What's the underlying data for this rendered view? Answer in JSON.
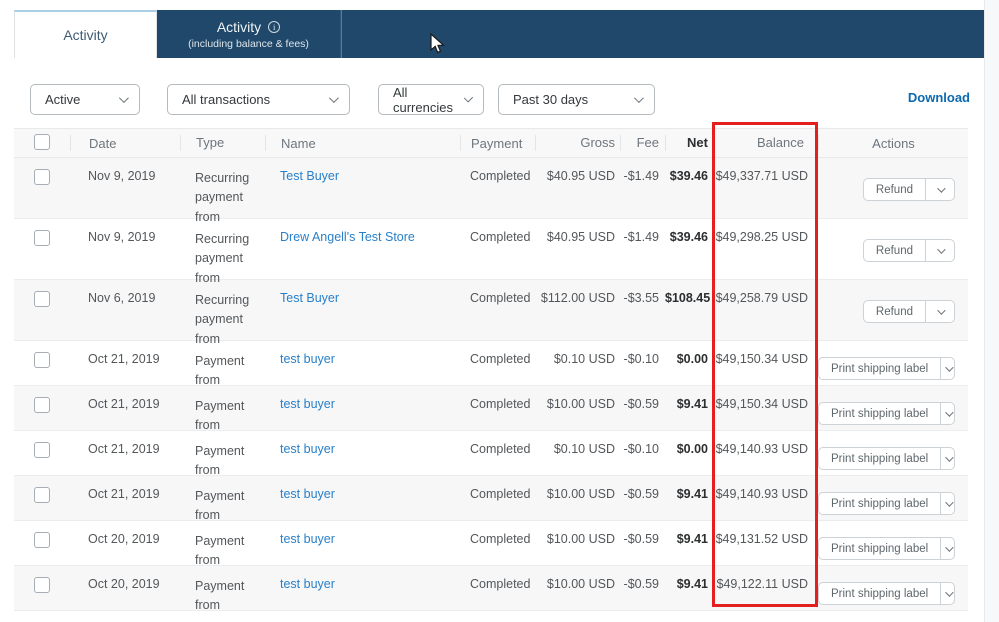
{
  "tabs": [
    {
      "label": "Activity",
      "active": true
    },
    {
      "label": "Activity",
      "sublabel": "(including balance & fees)",
      "info_icon": "i"
    }
  ],
  "filters": [
    {
      "name": "status-filter",
      "value": "Active"
    },
    {
      "name": "transaction-type-filter",
      "value": "All transactions"
    },
    {
      "name": "currency-filter",
      "value": "All currencies"
    },
    {
      "name": "date-range-filter",
      "value": "Past 30 days"
    }
  ],
  "download_label": "Download",
  "table": {
    "headers": [
      {
        "label": "Date"
      },
      {
        "label": "Type"
      },
      {
        "label": "Name"
      },
      {
        "label": "Payment"
      },
      {
        "label": "Gross"
      },
      {
        "label": "Fee"
      },
      {
        "label": "Net"
      },
      {
        "label": "Balance"
      },
      {
        "label": "Actions"
      }
    ],
    "rows": [
      {
        "date": "Nov 9, 2019",
        "type": "Recurring payment from",
        "name": "Test Buyer",
        "payment": "Completed",
        "gross": "$40.95 USD",
        "fee": "-$1.49",
        "net": "$39.46",
        "balance": "$49,337.71 USD",
        "action": "Refund"
      },
      {
        "date": "Nov 9, 2019",
        "type": "Recurring payment from",
        "name": "Drew Angell's Test Store",
        "payment": "Completed",
        "gross": "$40.95 USD",
        "fee": "-$1.49",
        "net": "$39.46",
        "balance": "$49,298.25 USD",
        "action": "Refund"
      },
      {
        "date": "Nov 6, 2019",
        "type": "Recurring payment from",
        "name": "Test Buyer",
        "payment": "Completed",
        "gross": "$112.00 USD",
        "fee": "-$3.55",
        "net": "$108.45",
        "balance": "$49,258.79 USD",
        "action": "Refund"
      },
      {
        "date": "Oct 21, 2019",
        "type": "Payment from",
        "name": "test buyer",
        "payment": "Completed",
        "gross": "$0.10 USD",
        "fee": "-$0.10",
        "net": "$0.00",
        "balance": "$49,150.34 USD",
        "action": "Print shipping label"
      },
      {
        "date": "Oct 21, 2019",
        "type": "Payment from",
        "name": "test buyer",
        "payment": "Completed",
        "gross": "$10.00 USD",
        "fee": "-$0.59",
        "net": "$9.41",
        "balance": "$49,150.34 USD",
        "action": "Print shipping label"
      },
      {
        "date": "Oct 21, 2019",
        "type": "Payment from",
        "name": "test buyer",
        "payment": "Completed",
        "gross": "$0.10 USD",
        "fee": "-$0.10",
        "net": "$0.00",
        "balance": "$49,140.93 USD",
        "action": "Print shipping label"
      },
      {
        "date": "Oct 21, 2019",
        "type": "Payment from",
        "name": "test buyer",
        "payment": "Completed",
        "gross": "$10.00 USD",
        "fee": "-$0.59",
        "net": "$9.41",
        "balance": "$49,140.93 USD",
        "action": "Print shipping label"
      },
      {
        "date": "Oct 20, 2019",
        "type": "Payment from",
        "name": "test buyer",
        "payment": "Completed",
        "gross": "$10.00 USD",
        "fee": "-$0.59",
        "net": "$9.41",
        "balance": "$49,131.52 USD",
        "action": "Print shipping label"
      },
      {
        "date": "Oct 20, 2019",
        "type": "Payment from",
        "name": "test buyer",
        "payment": "Completed",
        "gross": "$10.00 USD",
        "fee": "-$0.59",
        "net": "$9.41",
        "balance": "$49,122.11 USD",
        "action": "Print shipping label"
      }
    ]
  },
  "colors": {
    "navy": "#20486a",
    "highlight_red": "#e4201e",
    "link_blue": "#2980c9",
    "download_blue": "#0c69b0",
    "zebra_gray": "#f7f7f8"
  }
}
